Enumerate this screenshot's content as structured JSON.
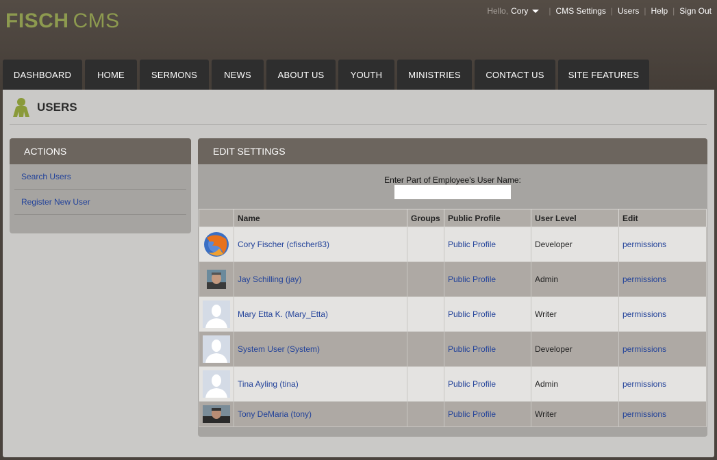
{
  "logo": {
    "bold": "FISCH",
    "thin": "CMS"
  },
  "topnav": {
    "hello": "Hello,",
    "user": "Cory",
    "links": [
      "CMS Settings",
      "Users",
      "Help",
      "Sign Out"
    ]
  },
  "tabs": [
    "DASHBOARD",
    "HOME",
    "SERMONS",
    "NEWS",
    "ABOUT US",
    "YOUTH",
    "MINISTRIES",
    "CONTACT US",
    "SITE FEATURES"
  ],
  "page": {
    "title": "USERS",
    "icon": "user-icon"
  },
  "actions": {
    "title": "ACTIONS",
    "items": [
      "Search Users",
      "Register New User"
    ]
  },
  "edit": {
    "title": "EDIT SETTINGS",
    "search_label": "Enter Part of Employee's User Name:",
    "search_value": ""
  },
  "table": {
    "headers": [
      "",
      "Name",
      "Groups",
      "Public Profile",
      "User Level",
      "Edit"
    ],
    "rows": [
      {
        "avatar": "firefox-avatar",
        "name": "Cory Fischer (cfischer83)",
        "groups": "",
        "profile": "Public Profile",
        "level": "Developer",
        "edit": "permissions"
      },
      {
        "avatar": "photo-avatar",
        "name": "Jay Schilling (jay)",
        "groups": "",
        "profile": "Public Profile",
        "level": "Admin",
        "edit": "permissions"
      },
      {
        "avatar": "default-avatar",
        "name": "Mary Etta K. (Mary_Etta)",
        "groups": "",
        "profile": "Public Profile",
        "level": "Writer",
        "edit": "permissions"
      },
      {
        "avatar": "default-avatar",
        "name": "System User (System)",
        "groups": "",
        "profile": "Public Profile",
        "level": "Developer",
        "edit": "permissions"
      },
      {
        "avatar": "default-avatar",
        "name": "Tina Ayling (tina)",
        "groups": "",
        "profile": "Public Profile",
        "level": "Admin",
        "edit": "permissions"
      },
      {
        "avatar": "photo-avatar",
        "name": "Tony DeMaria (tony)",
        "groups": "",
        "profile": "Public Profile",
        "level": "Writer",
        "edit": "permissions"
      }
    ]
  },
  "colors": {
    "accent": "#8d9a4f",
    "link": "#23439a",
    "tab_bg": "#2e2e2e",
    "panel_head": "#6c655e"
  }
}
